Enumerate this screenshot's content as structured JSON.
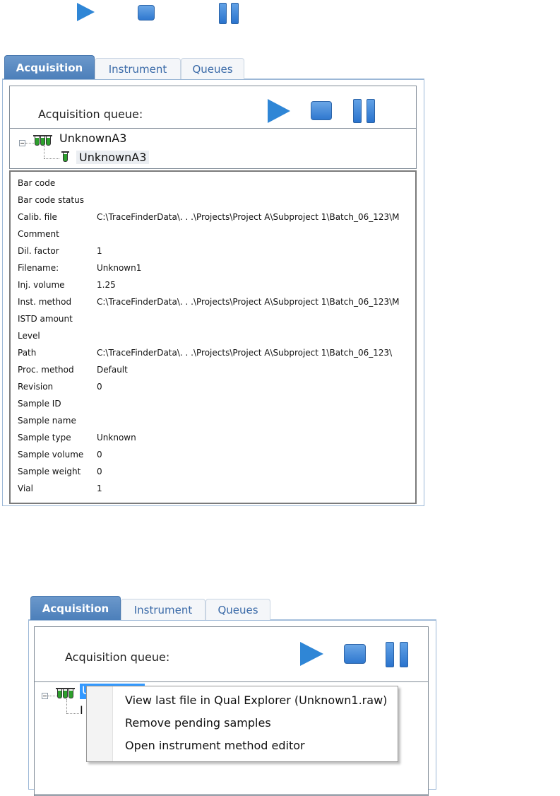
{
  "toolbar_icons": [
    "play-icon",
    "stop-icon",
    "pause-icon"
  ],
  "colors": {
    "accent": "#4c7fba",
    "tab_text": "#3a6aa8",
    "icon_blue": "#2f86d6",
    "selection": "#3399ff",
    "tube_green": "#2da02d"
  },
  "panel1": {
    "tabs": [
      {
        "label": "Acquisition"
      },
      {
        "label": "Instrument"
      },
      {
        "label": "Queues"
      }
    ],
    "queue_title": "Acquisition queue:",
    "tree": {
      "parent": "UnknownA3",
      "child": "UnknownA3"
    },
    "properties": [
      {
        "key": "Bar code",
        "value": ""
      },
      {
        "key": "Bar code status",
        "value": ""
      },
      {
        "key": "Calib. file",
        "value": "C:\\TraceFinderData\\. . .\\Projects\\Project A\\Subproject 1\\Batch_06_123\\M"
      },
      {
        "key": "Comment",
        "value": ""
      },
      {
        "key": "Dil. factor",
        "value": "1"
      },
      {
        "key": "Filename:",
        "value": "Unknown1"
      },
      {
        "key": "Inj. volume",
        "value": "1.25"
      },
      {
        "key": "Inst. method",
        "value": "C:\\TraceFinderData\\. . .\\Projects\\Project A\\Subproject 1\\Batch_06_123\\M"
      },
      {
        "key": "ISTD amount",
        "value": ""
      },
      {
        "key": "Level",
        "value": ""
      },
      {
        "key": "Path",
        "value": "C:\\TraceFinderData\\. . .\\Projects\\Project A\\Subproject 1\\Batch_06_123\\"
      },
      {
        "key": "Proc. method",
        "value": "Default"
      },
      {
        "key": "Revision",
        "value": "0"
      },
      {
        "key": "Sample ID",
        "value": ""
      },
      {
        "key": "Sample name",
        "value": ""
      },
      {
        "key": "Sample type",
        "value": "Unknown"
      },
      {
        "key": "Sample volume",
        "value": "0"
      },
      {
        "key": "Sample weight",
        "value": "0"
      },
      {
        "key": "Vial",
        "value": "1"
      }
    ]
  },
  "panel2": {
    "tabs": [
      {
        "label": "Acquisition"
      },
      {
        "label": "Instrument"
      },
      {
        "label": "Queues"
      }
    ],
    "queue_title": "Acquisition queue:",
    "tree": {
      "parent_partial": "U",
      "child_partial": "I"
    },
    "context_menu": [
      {
        "label": "View last file in Qual Explorer (Unknown1.raw)"
      },
      {
        "label": "Remove pending samples"
      },
      {
        "label": "Open instrument method editor"
      }
    ]
  }
}
